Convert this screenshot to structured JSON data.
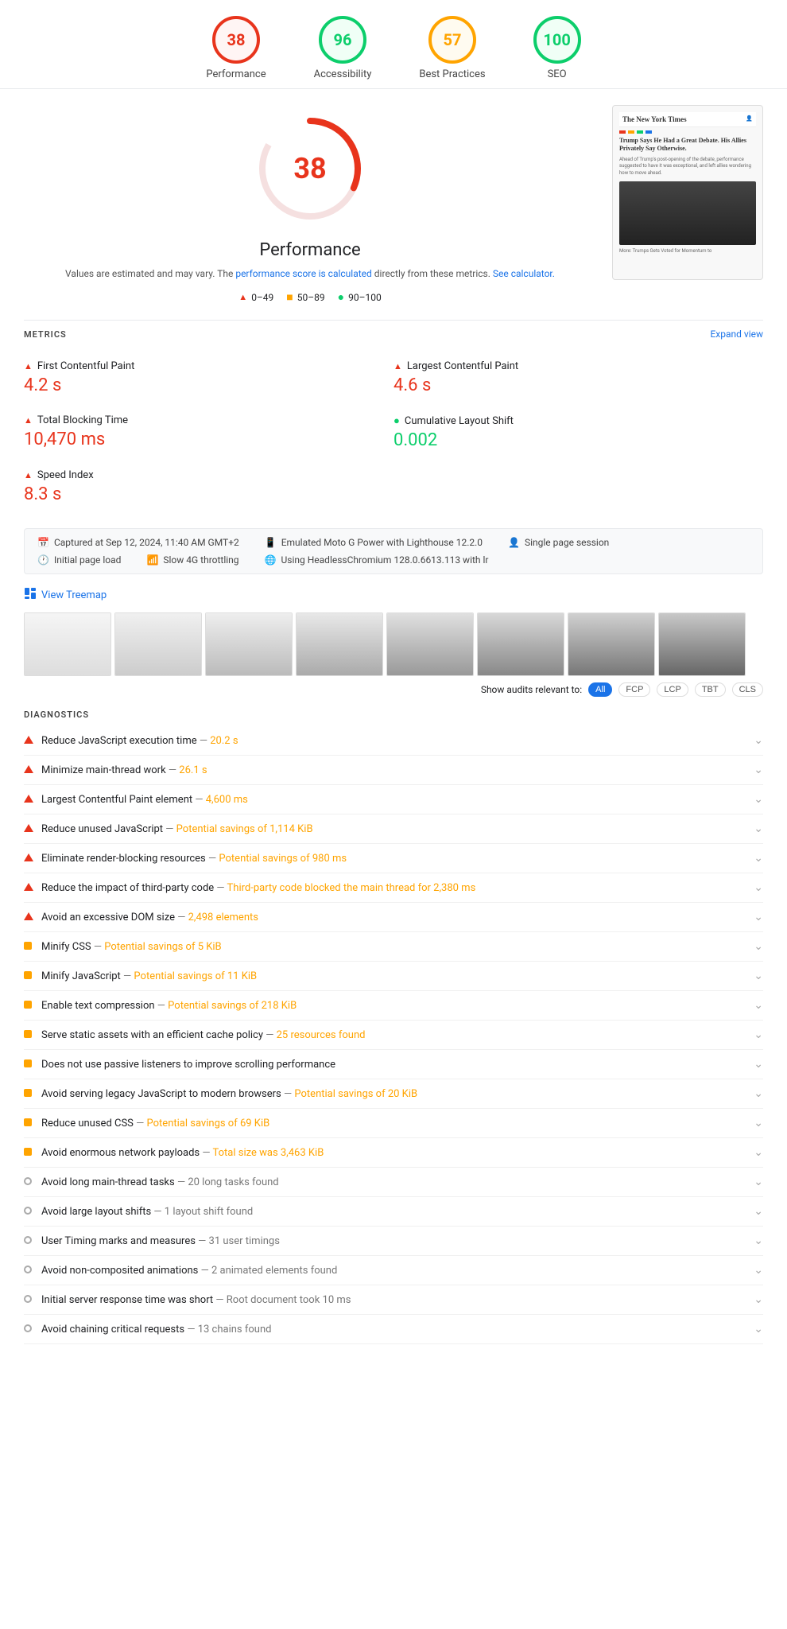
{
  "scores": [
    {
      "id": "performance",
      "value": "38",
      "label": "Performance",
      "type": "red"
    },
    {
      "id": "accessibility",
      "value": "96",
      "label": "Accessibility",
      "type": "green"
    },
    {
      "id": "best-practices",
      "value": "57",
      "label": "Best Practices",
      "type": "orange"
    },
    {
      "id": "seo",
      "value": "100",
      "label": "SEO",
      "type": "green"
    }
  ],
  "performance": {
    "score": "38",
    "title": "Performance",
    "desc_before": "Values are estimated and may vary. The ",
    "desc_link": "performance score is calculated",
    "desc_after": " directly from these metrics. ",
    "calc_link": "See calculator.",
    "legend": [
      {
        "icon": "triangle",
        "range": "0–49"
      },
      {
        "icon": "square",
        "range": "50–89"
      },
      {
        "icon": "circle",
        "range": "90–100"
      }
    ]
  },
  "metrics": {
    "label": "METRICS",
    "expand": "Expand view",
    "items": [
      {
        "id": "fcp",
        "name": "First Contentful Paint",
        "value": "4.2 s",
        "type": "red",
        "icon": "triangle"
      },
      {
        "id": "lcp",
        "name": "Largest Contentful Paint",
        "value": "4.6 s",
        "type": "red",
        "icon": "triangle"
      },
      {
        "id": "tbt",
        "name": "Total Blocking Time",
        "value": "10,470 ms",
        "type": "red",
        "icon": "triangle"
      },
      {
        "id": "cls",
        "name": "Cumulative Layout Shift",
        "value": "0.002",
        "type": "green",
        "icon": "circle"
      },
      {
        "id": "si",
        "name": "Speed Index",
        "value": "8.3 s",
        "type": "red",
        "icon": "triangle"
      }
    ]
  },
  "info_bar": {
    "items": [
      {
        "icon": "calendar",
        "text": "Captured at Sep 12, 2024, 11:40 AM GMT+2"
      },
      {
        "icon": "device",
        "text": "Emulated Moto G Power with Lighthouse 12.2.0"
      },
      {
        "icon": "user",
        "text": "Single page session"
      },
      {
        "icon": "clock",
        "text": "Initial page load"
      },
      {
        "icon": "wifi",
        "text": "Slow 4G throttling"
      },
      {
        "icon": "browser",
        "text": "Using HeadlessChromium 128.0.6613.113 with lr"
      }
    ]
  },
  "treemap": {
    "label": "View Treemap"
  },
  "audit_filter": {
    "show_label": "Show audits relevant to:",
    "buttons": [
      "All",
      "FCP",
      "LCP",
      "TBT",
      "CLS"
    ],
    "active": "All"
  },
  "diagnostics": {
    "label": "DIAGNOSTICS",
    "items": [
      {
        "icon": "triangle-red",
        "text": "Reduce JavaScript execution time",
        "detail": " — 20.2 s",
        "detail_class": "orange"
      },
      {
        "icon": "triangle-red",
        "text": "Minimize main-thread work",
        "detail": " — 26.1 s",
        "detail_class": "orange"
      },
      {
        "icon": "triangle-red",
        "text": "Largest Contentful Paint element",
        "detail": " — 4,600 ms",
        "detail_class": "orange"
      },
      {
        "icon": "triangle-red",
        "text": "Reduce unused JavaScript",
        "detail": " — Potential savings of 1,114 KiB",
        "detail_class": "orange"
      },
      {
        "icon": "triangle-red",
        "text": "Eliminate render-blocking resources",
        "detail": " — Potential savings of 980 ms",
        "detail_class": "orange"
      },
      {
        "icon": "triangle-red",
        "text": "Reduce the impact of third-party code",
        "detail": " — Third-party code blocked the main thread for 2,380 ms",
        "detail_class": "orange"
      },
      {
        "icon": "triangle-red",
        "text": "Avoid an excessive DOM size",
        "detail": " — 2,498 elements",
        "detail_class": "orange"
      },
      {
        "icon": "square-orange",
        "text": "Minify CSS",
        "detail": " — Potential savings of 5 KiB",
        "detail_class": "orange"
      },
      {
        "icon": "square-orange",
        "text": "Minify JavaScript",
        "detail": " — Potential savings of 11 KiB",
        "detail_class": "orange"
      },
      {
        "icon": "square-orange",
        "text": "Enable text compression",
        "detail": " — Potential savings of 218 KiB",
        "detail_class": "orange"
      },
      {
        "icon": "square-orange",
        "text": "Serve static assets with an efficient cache policy",
        "detail": " — 25 resources found",
        "detail_class": "orange"
      },
      {
        "icon": "square-orange",
        "text": "Does not use passive listeners to improve scrolling performance",
        "detail": "",
        "detail_class": "none"
      },
      {
        "icon": "square-orange",
        "text": "Avoid serving legacy JavaScript to modern browsers",
        "detail": " — Potential savings of 20 KiB",
        "detail_class": "orange"
      },
      {
        "icon": "square-orange",
        "text": "Reduce unused CSS",
        "detail": " — Potential savings of 69 KiB",
        "detail_class": "orange"
      },
      {
        "icon": "square-orange",
        "text": "Avoid enormous network payloads",
        "detail": " — Total size was 3,463 KiB",
        "detail_class": "orange"
      },
      {
        "icon": "circle-gray",
        "text": "Avoid long main-thread tasks",
        "detail": " — 20 long tasks found",
        "detail_class": "none"
      },
      {
        "icon": "circle-gray",
        "text": "Avoid large layout shifts",
        "detail": " — 1 layout shift found",
        "detail_class": "none"
      },
      {
        "icon": "circle-gray",
        "text": "User Timing marks and measures",
        "detail": " — 31 user timings",
        "detail_class": "none"
      },
      {
        "icon": "circle-gray",
        "text": "Avoid non-composited animations",
        "detail": " — 2 animated elements found",
        "detail_class": "none"
      },
      {
        "icon": "circle-gray",
        "text": "Initial server response time was short",
        "detail": " — Root document took 10 ms",
        "detail_class": "none"
      },
      {
        "icon": "circle-gray",
        "text": "Avoid chaining critical requests",
        "detail": " — 13 chains found",
        "detail_class": "none"
      }
    ]
  }
}
